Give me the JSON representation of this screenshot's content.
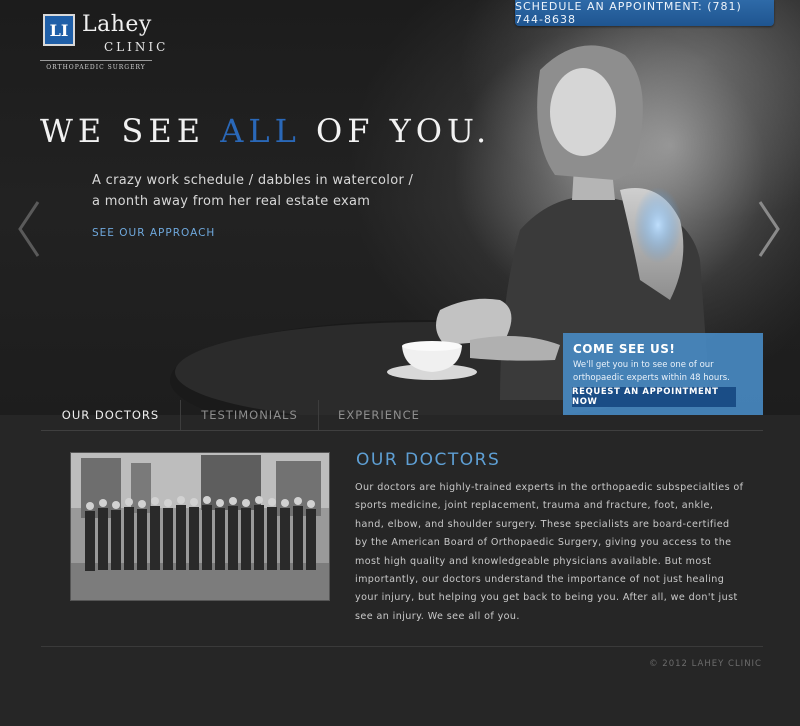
{
  "header": {
    "logo_name": "Lahey",
    "logo_clinic": "CLINIC",
    "logo_subtitle": "ORTHOPAEDIC SURGERY",
    "logo_mark": "LI",
    "schedule": "SCHEDULE AN APPOINTMENT: (781) 744-8638"
  },
  "hero": {
    "headline_before": "WE SEE",
    "headline_accent": "ALL",
    "headline_after": "OF YOU.",
    "tagline_line1": "A crazy work schedule / dabbles in watercolor /",
    "tagline_line2": "a month away from her real estate exam",
    "link": "SEE OUR APPROACH",
    "accent_color": "#2a68b8"
  },
  "cta": {
    "title": "COME SEE US!",
    "text": "We'll get you in to see one of our orthopaedic experts within 48 hours.",
    "button": "REQUEST AN APPOINTMENT NOW"
  },
  "tabs": [
    {
      "label": "OUR DOCTORS",
      "active": true
    },
    {
      "label": "TESTIMONIALS",
      "active": false
    },
    {
      "label": "EXPERIENCE",
      "active": false
    }
  ],
  "content": {
    "title": "OUR DOCTORS",
    "body": "Our doctors are highly-trained experts in the orthopaedic subspecialties of sports medicine, joint replacement, trauma and fracture, foot, ankle, hand, elbow, and shoulder surgery. These specialists are board-certified by the American Board of Orthopaedic Surgery, giving you access to the most high quality and knowledgeable physicians available. But most importantly, our doctors understand the importance of not just healing your injury, but helping you get back to being you. After all, we don't just see an injury. We see all of you."
  },
  "footer": {
    "copyright": "© 2012 LAHEY CLINIC"
  },
  "colors": {
    "brand_blue": "#1f5fa8",
    "link_blue": "#6fa8dc",
    "title_blue": "#5e9fd4",
    "cta_blue": "#488bc4"
  }
}
